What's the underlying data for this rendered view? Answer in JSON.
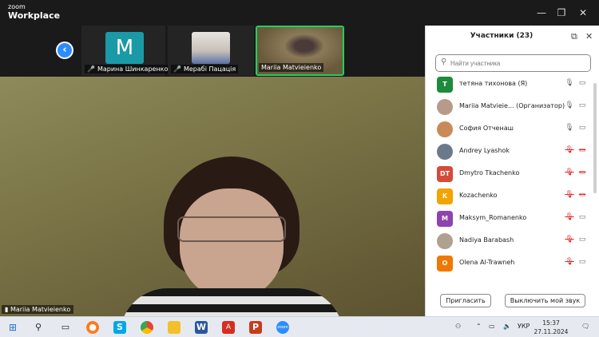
{
  "app": {
    "logo_line1": "zoom",
    "logo_line2": "Workplace"
  },
  "window_controls": {
    "minimize": "—",
    "restore": "❐",
    "close": "✕"
  },
  "strip": {
    "nav_icon": "chevron-left-icon",
    "nav_glyph": "‹",
    "thumbnails": [
      {
        "name": "Марина Шинкаренко",
        "avatar_letter": "M",
        "muted": true
      },
      {
        "name": "Мерабі Пацація",
        "muted": true
      },
      {
        "name": "Mariia Matvieienko",
        "active": true
      }
    ]
  },
  "main": {
    "speaker_name": "Mariia Matvieienko"
  },
  "panel": {
    "title": "Участники (23)",
    "search_placeholder": "Найти участника",
    "participants": [
      {
        "name": "тетяна тихонова (Я)",
        "avatar": "Т",
        "color": "#1e8a3c",
        "mic": "on",
        "cam": "on"
      },
      {
        "name": "Mariia Matvieie... (Организатор)",
        "avatar": "",
        "color": "#b89a8a",
        "photo": true,
        "mic": "on",
        "cam": "on"
      },
      {
        "name": "София Отченаш",
        "avatar": "",
        "color": "#c98a5a",
        "photo": true,
        "mic": "on",
        "cam": "on"
      },
      {
        "name": "Andrey Lyashok",
        "avatar": "",
        "color": "#6a7a8a",
        "photo": true,
        "mic": "off",
        "cam": "off"
      },
      {
        "name": "Dmytro Tkachenko",
        "avatar": "DT",
        "color": "#d64a3a",
        "mic": "off",
        "cam": "off"
      },
      {
        "name": "Kozachenko",
        "avatar": "K",
        "color": "#f0a500",
        "mic": "off",
        "cam": "off"
      },
      {
        "name": "Maksym_Romanenko",
        "avatar": "M",
        "color": "#8e44ad",
        "mic": "off",
        "cam": "on"
      },
      {
        "name": "Nadiya Barabash",
        "avatar": "",
        "color": "#b0a090",
        "photo": true,
        "mic": "off",
        "cam": "on"
      },
      {
        "name": "Olena Al-Trawneh",
        "avatar": "O",
        "color": "#f07800",
        "mic": "off",
        "cam": "on"
      }
    ],
    "invite_label": "Пригласить",
    "mute_label": "Выключить мой звук"
  },
  "taskbar": {
    "lang": "УКР",
    "time": "15:37",
    "date": "27.11.2024"
  },
  "colors": {
    "accent": "#2d8cff",
    "active_border": "#23d05a",
    "muted": "#e02828"
  }
}
